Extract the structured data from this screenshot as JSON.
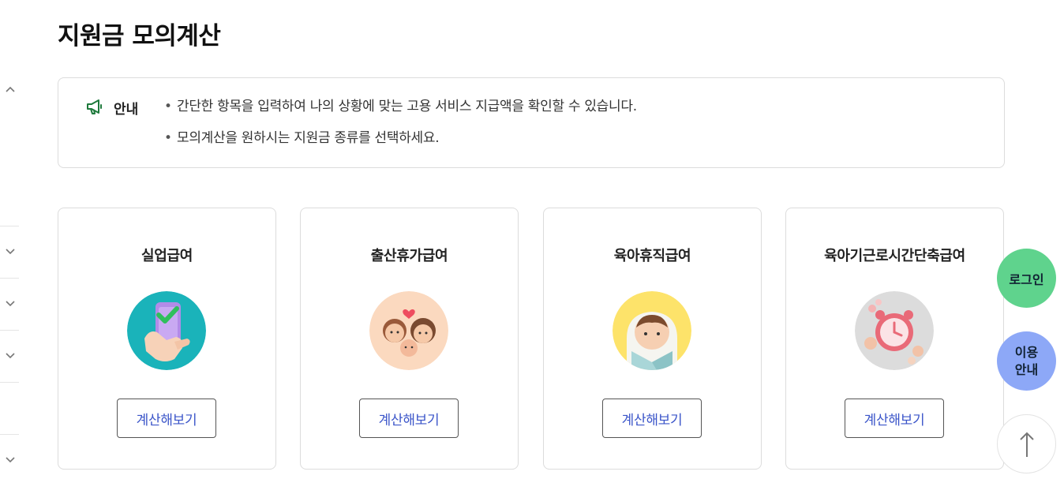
{
  "page": {
    "title": "지원금 모의계산"
  },
  "info": {
    "label": "안내",
    "icon": "megaphone-icon",
    "items": [
      "간단한 항목을 입력하여 나의 상황에 맞는 고용 서비스 지급액을 확인할 수 있습니다.",
      "모의계산을 원하시는 지원금 종류를 선택하세요."
    ]
  },
  "cards": [
    {
      "title": "실업급여",
      "button": "계산해보기",
      "icon": "phone-check-icon"
    },
    {
      "title": "출산휴가급여",
      "button": "계산해보기",
      "icon": "family-icon"
    },
    {
      "title": "육아휴직급여",
      "button": "계산해보기",
      "icon": "baby-icon"
    },
    {
      "title": "육아기근로시간단축급여",
      "button": "계산해보기",
      "icon": "alarm-clock-icon"
    }
  ],
  "floating": {
    "login": "로그인",
    "guide_line1": "이용",
    "guide_line2": "안내",
    "top_icon": "arrow-up-icon"
  },
  "colors": {
    "accent_text": "#3b55c9",
    "login_bg": "#5fd38d",
    "guide_bg": "#8da8f7",
    "megaphone": "#1e7a3c"
  }
}
